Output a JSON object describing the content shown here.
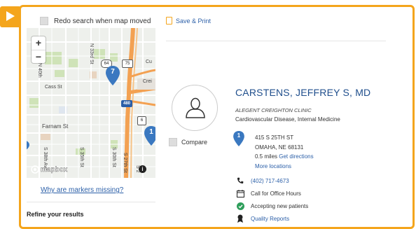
{
  "map_panel": {
    "redo_label": "Redo search when map moved",
    "zoom_in": "+",
    "zoom_out": "−",
    "labels": {
      "cass": "Cass St",
      "farnam": "Farnam St",
      "creighton": "Crei",
      "cu": "Cu",
      "n40": "N 40th",
      "n33": "N 33rd St",
      "s38": "S 38th Ave",
      "s35": "S 35th St",
      "s30": "S 30th St",
      "s27": "S 27th St",
      "s2": "S 2",
      "hwy64": "64",
      "hwy75": "75",
      "hwy6": "6",
      "i480": "480"
    },
    "markers": [
      "7",
      "1"
    ],
    "logo_text": "mapbox",
    "info_icon": "i",
    "missing_link": "Why are markers missing?"
  },
  "refine_label": "Refine your results",
  "save_print_label": "Save & Print",
  "compare_label": "Compare",
  "doctor": {
    "name": "CARSTENS, JEFFREY S, MD",
    "clinic": "ALEGENT CREIGHTON CLINIC",
    "specialty": "Cardiovascular Disease, Internal Medicine",
    "marker_number": "1",
    "address_line1": "415 S 25TH ST",
    "address_line2": "OMAHA, NE 68131",
    "distance": "0.5 miles",
    "directions": "Get directions",
    "more_locations": "More locations",
    "phone": "(402) 717-4673",
    "hours": "Call for Office Hours",
    "accepting": "Accepting new patients",
    "quality": "Quality Reports"
  },
  "colors": {
    "accent": "#f4a51c",
    "link": "#2b5fa8",
    "name": "#1f4e8c",
    "marker": "#3a78c0",
    "check": "#2e9e5b"
  }
}
